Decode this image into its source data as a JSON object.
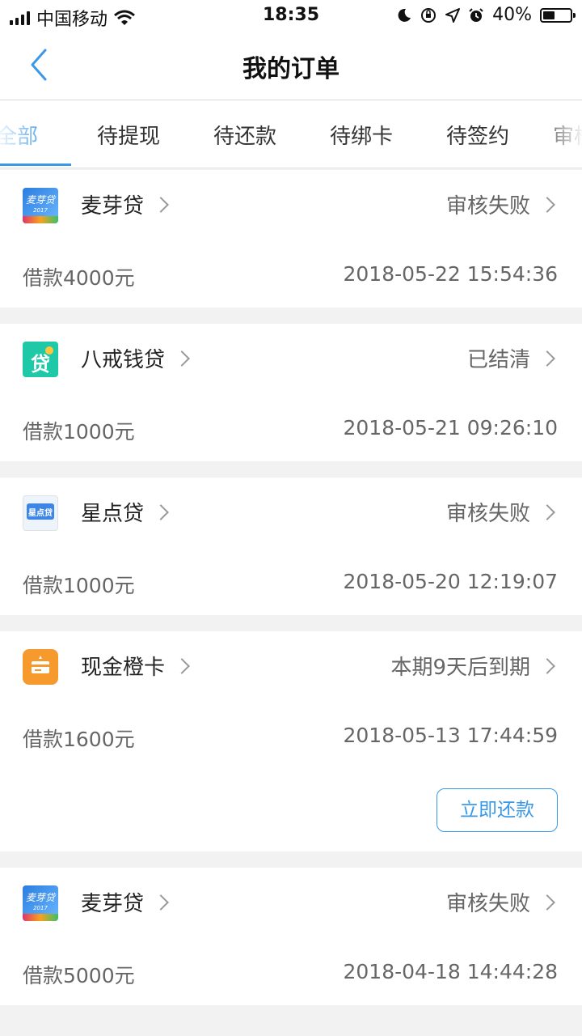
{
  "status_bar": {
    "carrier": "中国移动",
    "time": "18:35",
    "battery": "40%"
  },
  "nav": {
    "title": "我的订单"
  },
  "tabs": [
    {
      "label": "全部",
      "active": true
    },
    {
      "label": "待提现"
    },
    {
      "label": "待还款"
    },
    {
      "label": "待绑卡"
    },
    {
      "label": "待签约"
    },
    {
      "label": "审核"
    }
  ],
  "orders": [
    {
      "app": "麦芽贷",
      "status": "审核失败",
      "amount": "借款4000元",
      "datetime": "2018-05-22 15:54:36",
      "icon": "maiyadai-logo-icon",
      "icon_text": "麦芽贷",
      "icon_sub": "2017"
    },
    {
      "app": "八戒钱贷",
      "status": "已结清",
      "amount": "借款1000元",
      "datetime": "2018-05-21 09:26:10",
      "icon": "bajie-logo-icon",
      "icon_text": "贷"
    },
    {
      "app": "星点贷",
      "status": "审核失败",
      "amount": "借款1000元",
      "datetime": "2018-05-20 12:19:07",
      "icon": "xingdian-logo-icon",
      "icon_text": "星点贷"
    },
    {
      "app": "现金橙卡",
      "status": "本期9天后到期",
      "amount": "借款1600元",
      "datetime": "2018-05-13 17:44:59",
      "icon": "chengka-logo-icon",
      "button": "立即还款"
    },
    {
      "app": "麦芽贷",
      "status": "审核失败",
      "amount": "借款5000元",
      "datetime": "2018-04-18 14:44:28",
      "icon": "maiyadai-logo-icon",
      "icon_text": "麦芽贷",
      "icon_sub": "2017"
    }
  ],
  "colors": {
    "accent": "#3a98e8",
    "background": "#f2f2f2"
  }
}
